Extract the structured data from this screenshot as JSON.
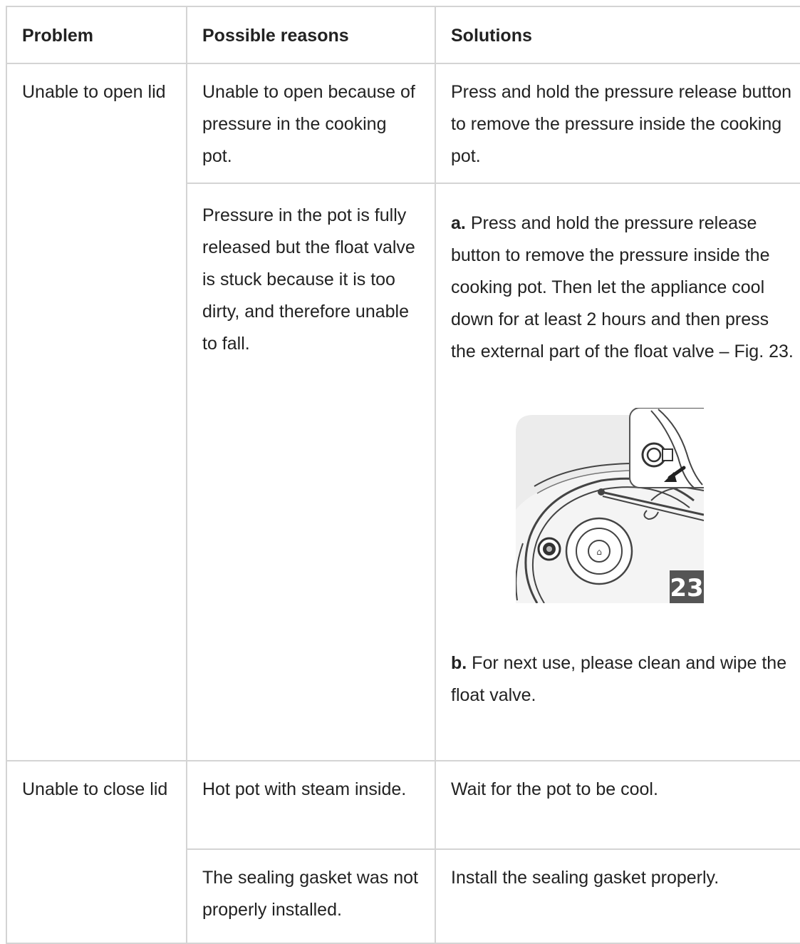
{
  "table": {
    "headers": [
      "Problem",
      "Possible reasons",
      "Solutions"
    ],
    "rows": [
      {
        "problem": "Unable to open lid",
        "reasons": [
          {
            "text": "Unable to open because of pressure in the cooking pot.",
            "solution": "Press and hold the pressure release button to remove the pressure inside the cooking pot."
          },
          {
            "text": "Pressure in the pot is fully released but the float valve is stuck because it is too dirty, and therefore unable to fall.",
            "solution_steps": [
              {
                "label": "a.",
                "text": "Press and hold the pressure release button to remove the pressure inside the cooking pot. Then let the appliance cool down for at least 2 hours and then press the external part of the float valve – Fig. 23."
              },
              {
                "label": "b.",
                "text": "For next use, please clean and wipe the float valve."
              }
            ],
            "figure": {
              "number": "23",
              "icon": "float-valve-illustration"
            }
          }
        ]
      },
      {
        "problem": "Unable to close lid",
        "reasons": [
          {
            "text": "Hot pot with steam inside.",
            "solution": "Wait for the pot to be cool."
          },
          {
            "text": "The sealing gasket was not properly installed.",
            "solution": "Install the sealing gasket properly."
          }
        ]
      }
    ]
  },
  "colors": {
    "border": "#d4d4d4",
    "text": "#222222",
    "figure_badge": "#555555"
  }
}
